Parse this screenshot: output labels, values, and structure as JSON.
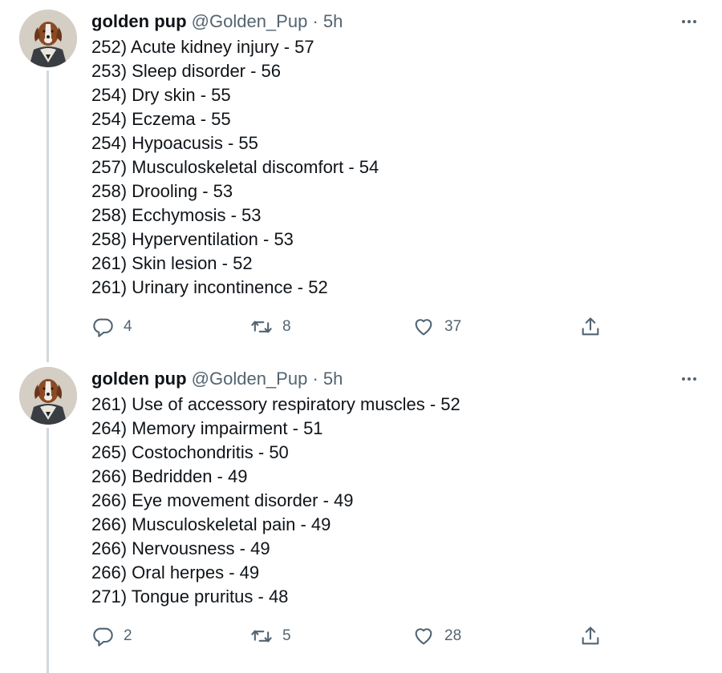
{
  "tweets": [
    {
      "author": {
        "name": "golden pup",
        "handle": "@Golden_Pup",
        "separator": "·",
        "time": "5h"
      },
      "lines": [
        "252) Acute kidney injury - 57",
        "253) Sleep disorder - 56",
        "254) Dry skin - 55",
        "254) Eczema - 55",
        "254) Hypoacusis - 55",
        "257) Musculoskeletal discomfort - 54",
        "258) Drooling - 53",
        "258) Ecchymosis - 53",
        "258) Hyperventilation - 53",
        "261) Skin lesion - 52",
        "261) Urinary incontinence - 52"
      ],
      "stats": {
        "replies": "4",
        "retweets": "8",
        "likes": "37"
      }
    },
    {
      "author": {
        "name": "golden pup",
        "handle": "@Golden_Pup",
        "separator": "·",
        "time": "5h"
      },
      "lines": [
        "261) Use of accessory respiratory muscles - 52",
        "264) Memory impairment - 51",
        "265) Costochondritis - 50",
        "266) Bedridden - 49",
        "266) Eye movement disorder - 49",
        "266) Musculoskeletal pain - 49",
        "266) Nervousness - 49",
        "266) Oral herpes - 49",
        "271) Tongue pruritus - 48"
      ],
      "stats": {
        "replies": "2",
        "retweets": "5",
        "likes": "28"
      }
    }
  ],
  "icons": {
    "reply": "reply-icon",
    "retweet": "retweet-icon",
    "like": "heart-icon",
    "share": "share-icon",
    "more": "more-icon"
  },
  "colors": {
    "text": "#0f1419",
    "secondary": "#536471",
    "thread_line": "#cfd9de",
    "background": "#ffffff"
  }
}
